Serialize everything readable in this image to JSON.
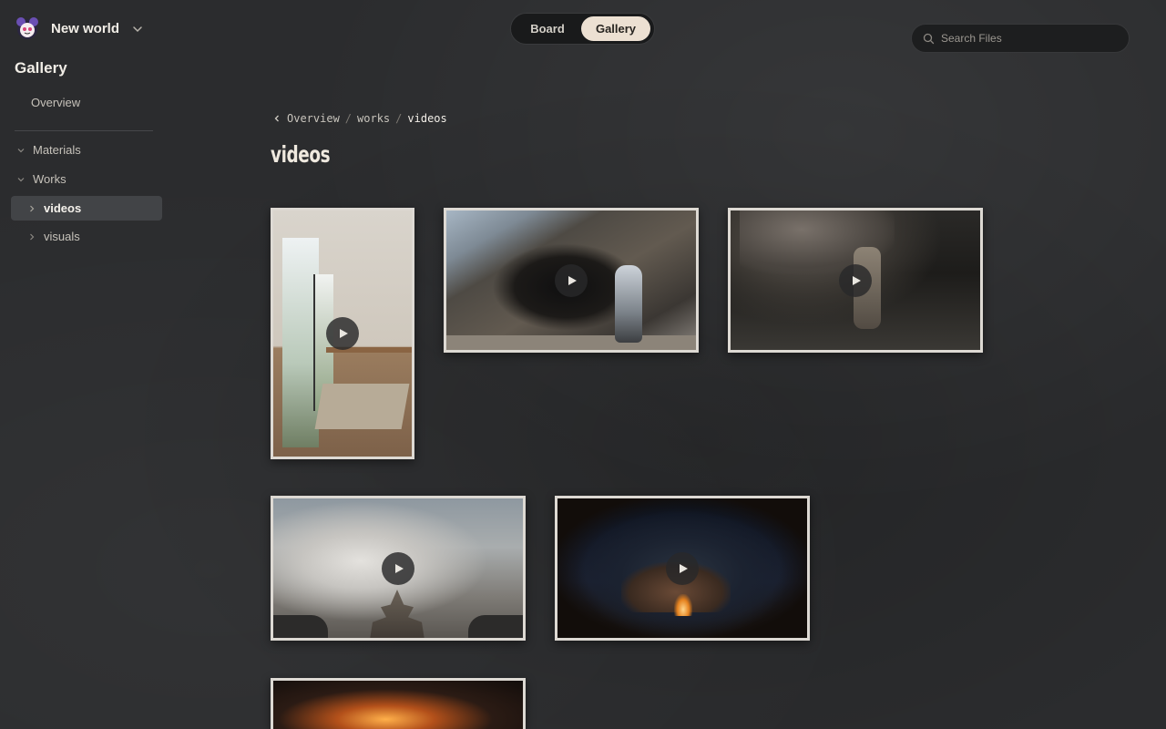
{
  "workspace": {
    "name": "New world"
  },
  "sidebar": {
    "title": "Gallery",
    "overview": "Overview",
    "tree": [
      {
        "label": "Materials",
        "expanded": false
      },
      {
        "label": "Works",
        "expanded": true
      },
      {
        "label": "videos",
        "selected": true
      },
      {
        "label": "visuals",
        "selected": false
      }
    ]
  },
  "view_toggle": {
    "board": "Board",
    "gallery": "Gallery",
    "active": "Gallery"
  },
  "search": {
    "placeholder": "Search Files"
  },
  "breadcrumb": {
    "items": [
      "Overview",
      "works",
      "videos"
    ],
    "separator": "/"
  },
  "page": {
    "title": "videos"
  },
  "gallery": {
    "items": [
      {
        "kind": "video",
        "icon": "play-icon"
      },
      {
        "kind": "video",
        "icon": "play-icon"
      },
      {
        "kind": "video",
        "icon": "play-icon"
      },
      {
        "kind": "video",
        "icon": "play-icon"
      },
      {
        "kind": "video",
        "icon": "play-icon"
      },
      {
        "kind": "video",
        "icon": "play-icon"
      }
    ]
  },
  "colors": {
    "background": "#2b2c2e",
    "selected_item": "#424447",
    "toggle_active": "#ece0d2",
    "tile_border": "#ddd9d3"
  }
}
